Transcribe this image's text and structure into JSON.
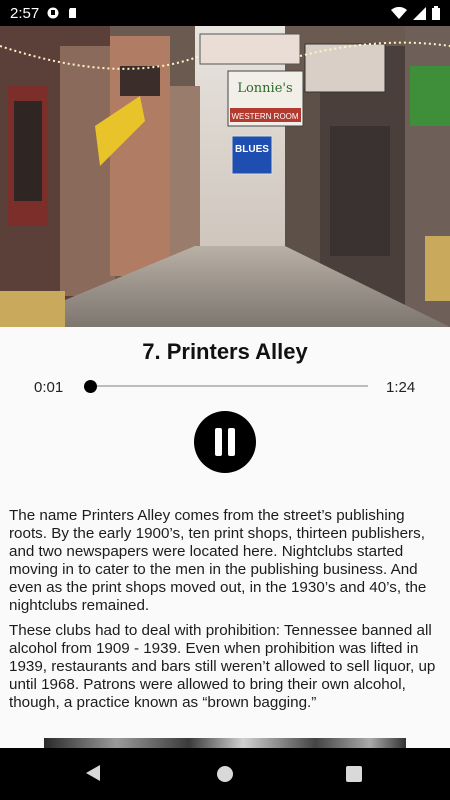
{
  "status_bar": {
    "time": "2:57",
    "icons": [
      "notification-icon",
      "sd-card-icon",
      "wifi-icon",
      "signal-icon",
      "battery-icon"
    ]
  },
  "hero": {
    "description_icon": "alley-photo",
    "signs": [
      "Lonnie's",
      "WESTERN ROOM",
      "BLUES"
    ]
  },
  "player": {
    "title": "7. Printers Alley",
    "current_time": "0:01",
    "total_time": "1:24",
    "progress_fraction": 0.012,
    "state": "playing"
  },
  "body": {
    "paragraphs": [
      "The name Printers Alley comes from the street’s publishing roots. By the early 1900’s, ten print shops, thirteen publishers, and two newspapers were located here. Nightclubs started moving in to cater to the men in the publishing business. And even as the print shops moved out, in the 1930’s and 40’s, the nightclubs remained.",
      "These clubs had to deal with prohibition: Tennessee banned all alcohol from 1909 - 1939. Even when prohibition was lifted in 1939, restaurants and bars still weren’t allowed to sell liquor, up until 1968. Patrons were allowed to bring their own alcohol, though, a practice known as “brown bagging.”"
    ]
  },
  "nav_bar": {
    "icons": [
      "back-icon",
      "home-icon",
      "recents-icon"
    ]
  }
}
